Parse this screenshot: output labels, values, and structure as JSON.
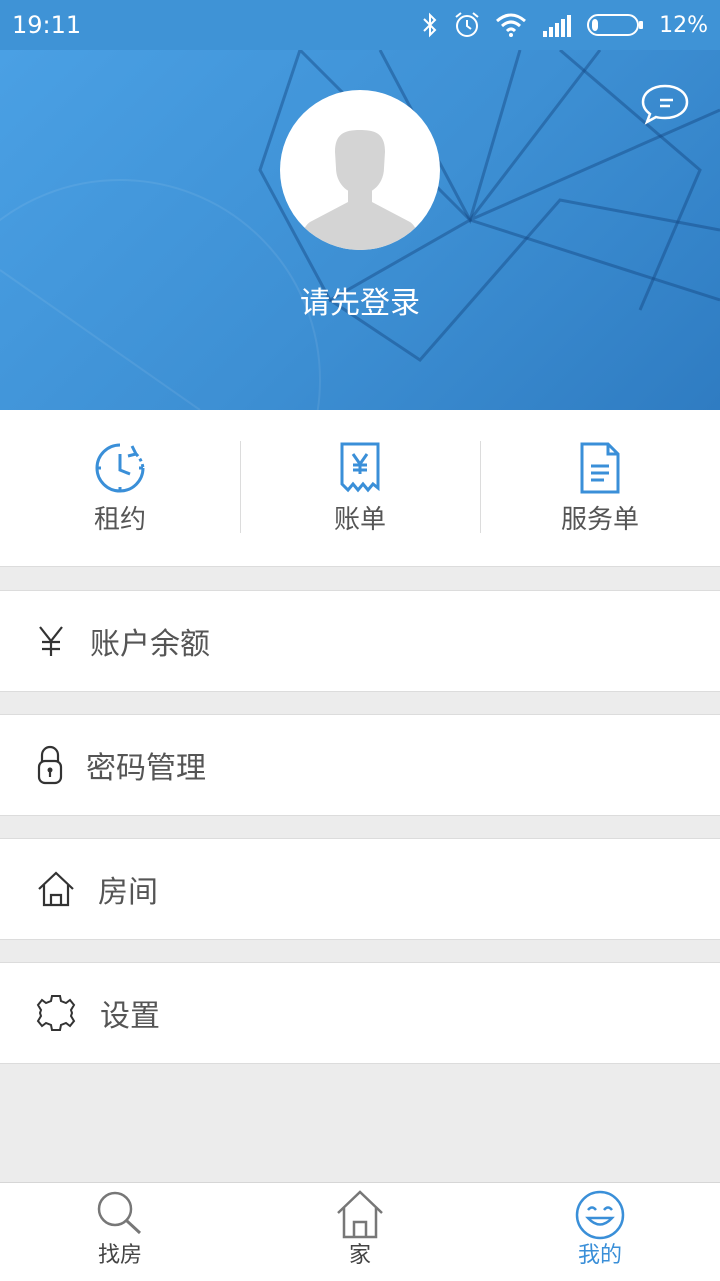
{
  "status_bar": {
    "time": "19:11",
    "battery": "12%",
    "icons": [
      "bluetooth-icon",
      "alarm-icon",
      "wifi-icon",
      "signal-icon",
      "battery-icon"
    ]
  },
  "profile": {
    "login_prompt": "请先登录",
    "avatar_icon": "default-avatar-icon",
    "message_icon": "message-bubble-icon"
  },
  "quick_actions": [
    {
      "label": "租约",
      "icon": "lease-clock-icon"
    },
    {
      "label": "账单",
      "icon": "bill-receipt-icon"
    },
    {
      "label": "服务单",
      "icon": "service-document-icon"
    }
  ],
  "menu": [
    {
      "label": "账户余额",
      "icon": "yen-icon"
    },
    {
      "label": "密码管理",
      "icon": "lock-icon"
    },
    {
      "label": "房间",
      "icon": "house-icon"
    },
    {
      "label": "设置",
      "icon": "gear-icon"
    }
  ],
  "tabs": [
    {
      "label": "找房",
      "icon": "search-icon",
      "active": false
    },
    {
      "label": "家",
      "icon": "home-icon",
      "active": false
    },
    {
      "label": "我的",
      "icon": "smile-icon",
      "active": true
    }
  ],
  "colors": {
    "accent": "#3a8fd8",
    "header_bg": "#3f93d6",
    "page_bg": "#ececec",
    "text": "#555555"
  }
}
